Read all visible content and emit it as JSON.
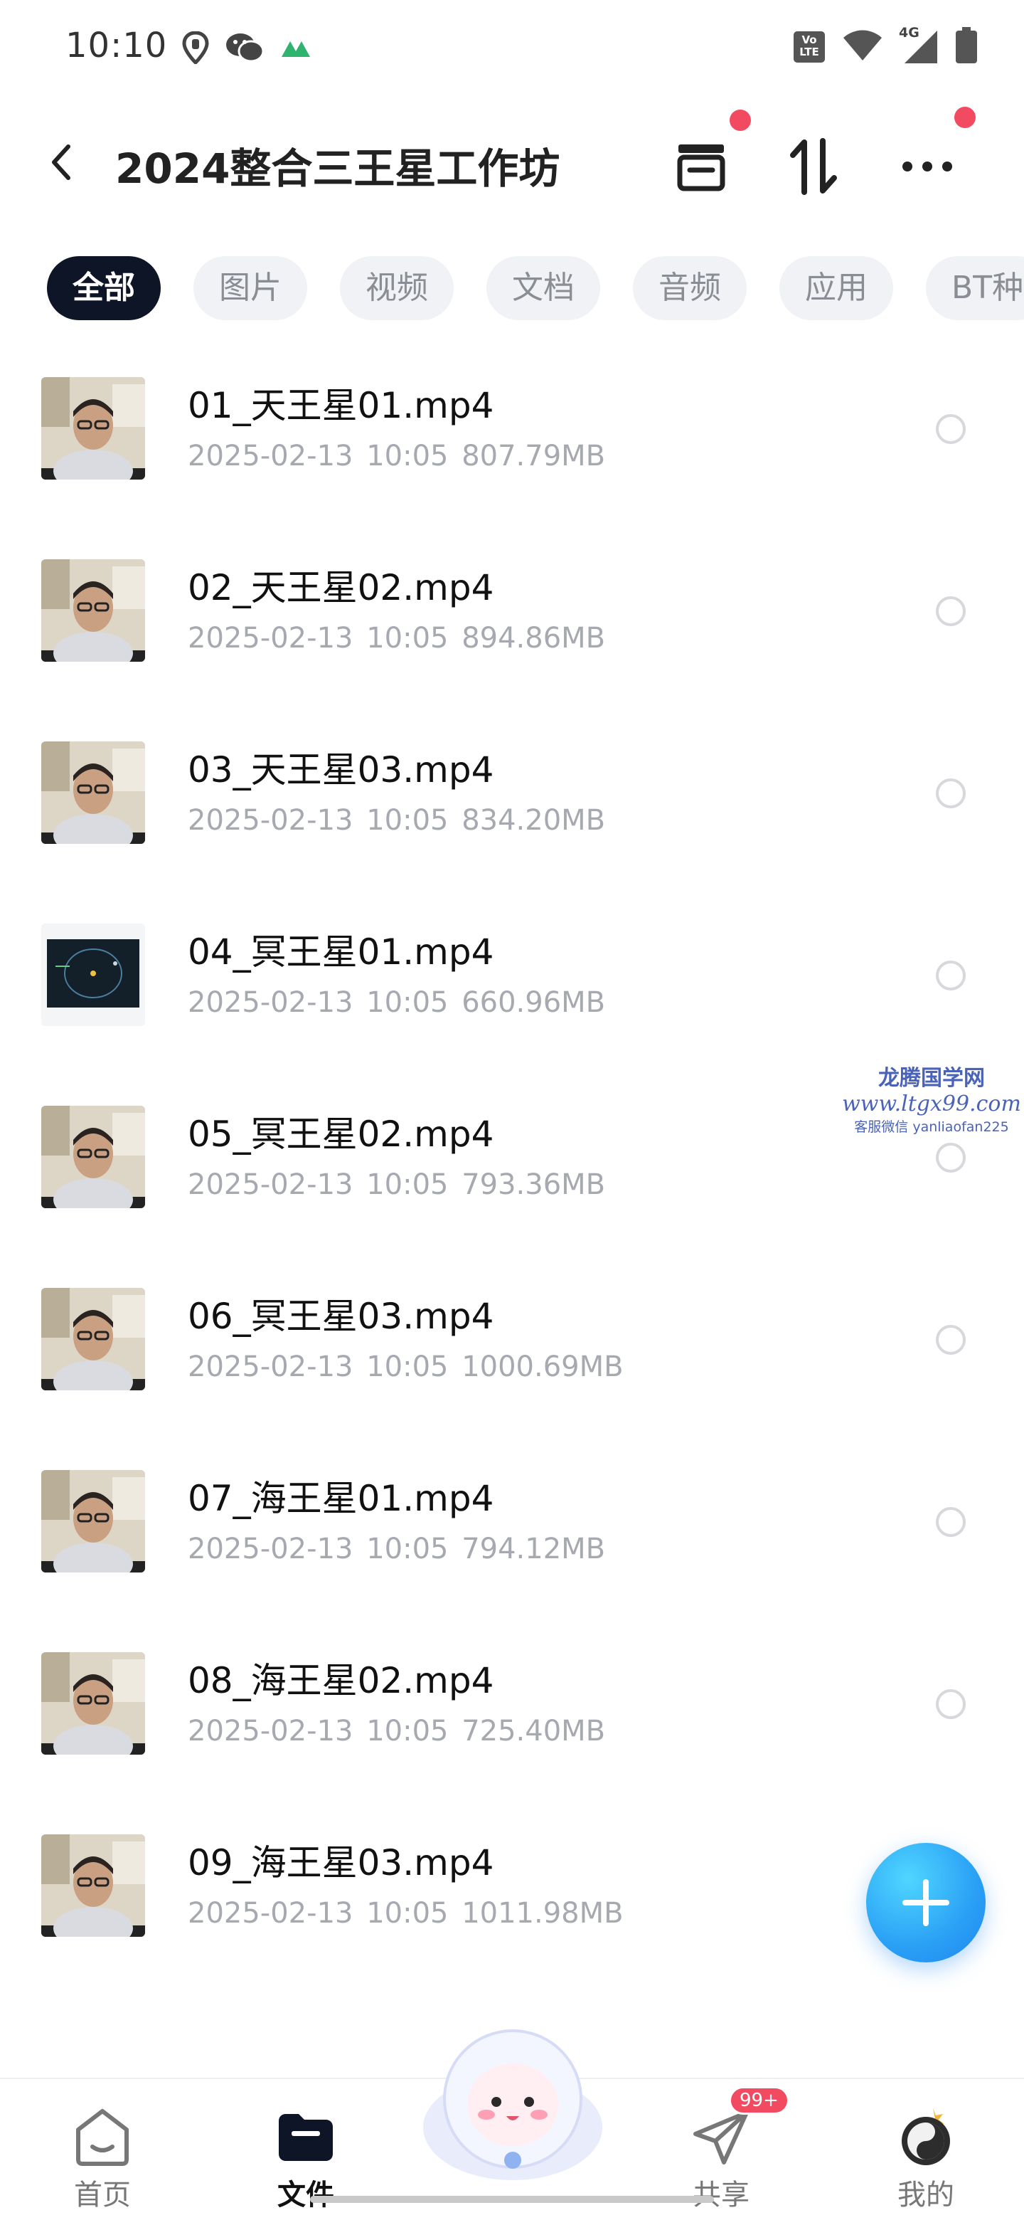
{
  "status_bar": {
    "time": "10:10",
    "left_icons": [
      "location-pin-icon",
      "wechat-icon",
      "app-notification-icon"
    ],
    "right_icons": [
      "volte-icon",
      "wifi-icon",
      "signal-4g-icon",
      "battery-icon"
    ],
    "volte_label": "Vo LTE",
    "network_label": "4G"
  },
  "header": {
    "title": "2024整合三王星工作坊",
    "buttons": [
      "archive-icon",
      "sort-icon",
      "more-icon"
    ]
  },
  "tabs": [
    {
      "label": "全部",
      "active": true
    },
    {
      "label": "图片",
      "active": false
    },
    {
      "label": "视频",
      "active": false
    },
    {
      "label": "文档",
      "active": false
    },
    {
      "label": "音频",
      "active": false
    },
    {
      "label": "应用",
      "active": false
    },
    {
      "label": "BT种",
      "active": false
    }
  ],
  "files": [
    {
      "name": "01_天王星01.mp4",
      "date": "2025-02-13",
      "time": "10:05",
      "size": "807.79MB",
      "thumb": "person"
    },
    {
      "name": "02_天王星02.mp4",
      "date": "2025-02-13",
      "time": "10:05",
      "size": "894.86MB",
      "thumb": "person"
    },
    {
      "name": "03_天王星03.mp4",
      "date": "2025-02-13",
      "time": "10:05",
      "size": "834.20MB",
      "thumb": "person"
    },
    {
      "name": "04_冥王星01.mp4",
      "date": "2025-02-13",
      "time": "10:05",
      "size": "660.96MB",
      "thumb": "orbit"
    },
    {
      "name": "05_冥王星02.mp4",
      "date": "2025-02-13",
      "time": "10:05",
      "size": "793.36MB",
      "thumb": "person"
    },
    {
      "name": "06_冥王星03.mp4",
      "date": "2025-02-13",
      "time": "10:05",
      "size": "1000.69MB",
      "thumb": "person"
    },
    {
      "name": "07_海王星01.mp4",
      "date": "2025-02-13",
      "time": "10:05",
      "size": "794.12MB",
      "thumb": "person"
    },
    {
      "name": "08_海王星02.mp4",
      "date": "2025-02-13",
      "time": "10:05",
      "size": "725.40MB",
      "thumb": "person"
    },
    {
      "name": "09_海王星03.mp4",
      "date": "2025-02-13",
      "time": "10:05",
      "size": "1011.98MB",
      "thumb": "person"
    }
  ],
  "watermark": {
    "line1": "龙腾国学网",
    "line2": "www.ltgx99.com",
    "line3": "客服微信 yanliaofan225"
  },
  "bottom_nav": [
    {
      "label": "首页",
      "icon": "home-icon",
      "active": false
    },
    {
      "label": "文件",
      "icon": "folder-icon",
      "active": true
    },
    {
      "label": "共享",
      "icon": "share-icon",
      "active": false,
      "badge": "99+"
    },
    {
      "label": "我的",
      "icon": "avatar-icon",
      "active": false
    }
  ],
  "colors": {
    "accent_blue": "#2aa0f5",
    "active_tab_bg": "#0e1526",
    "red_dot": "#f24a61",
    "meta_text": "#a6a9b0"
  }
}
